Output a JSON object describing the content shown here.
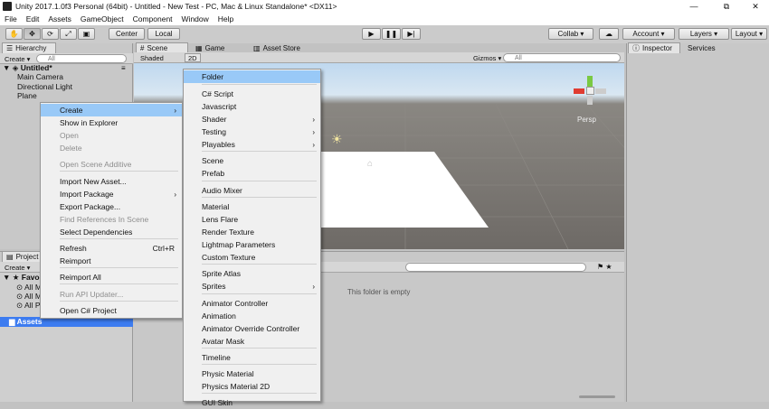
{
  "window": {
    "title": "Unity 2017.1.0f3 Personal (64bit) - Untitled - New Test - PC, Mac & Linux Standalone* <DX11>",
    "minimize": "—",
    "restore": "⧉",
    "close": "✕"
  },
  "menubar": [
    "File",
    "Edit",
    "Assets",
    "GameObject",
    "Component",
    "Window",
    "Help"
  ],
  "toolbar": {
    "center": "Center",
    "local": "Local",
    "collab": "Collab ▾",
    "cloud": "☁",
    "account": "Account",
    "layers": "Layers",
    "layout": "Layout"
  },
  "hierarchy": {
    "tab": "Hierarchy",
    "create": "Create ▾",
    "search_placeholder": "All",
    "scene_name": "Untitled*",
    "items": [
      "Main Camera",
      "Directional Light",
      "Plane"
    ]
  },
  "scene": {
    "tabs": [
      "Scene",
      "Game",
      "Asset Store"
    ],
    "shading": "Shaded",
    "mode_2d": "2D",
    "gizmos": "Gizmos ▾",
    "search_placeholder": "All",
    "persp": "Persp"
  },
  "inspector": {
    "tabs": [
      "Inspector",
      "Services"
    ]
  },
  "project": {
    "tab": "Project",
    "create": "Create ▾",
    "favorites": "Favori",
    "fav_items": [
      "All M",
      "All M",
      "All P"
    ],
    "assets": "Assets",
    "empty_text": "This folder is empty"
  },
  "context_menu": {
    "items": [
      {
        "label": "Create",
        "submenu": true,
        "highlight": true
      },
      {
        "label": "Show in Explorer"
      },
      {
        "label": "Open",
        "disabled": true
      },
      {
        "label": "Delete",
        "disabled": true
      },
      {
        "label": "Open Scene Additive",
        "disabled": true
      },
      {
        "label": "Import New Asset..."
      },
      {
        "label": "Import Package",
        "submenu": true
      },
      {
        "label": "Export Package..."
      },
      {
        "label": "Find References In Scene",
        "disabled": true
      },
      {
        "label": "Select Dependencies"
      },
      {
        "label": "Refresh",
        "shortcut": "Ctrl+R"
      },
      {
        "label": "Reimport"
      },
      {
        "label": "Reimport All"
      },
      {
        "label": "Run API Updater...",
        "disabled": true
      },
      {
        "label": "Open C# Project"
      }
    ]
  },
  "create_submenu": {
    "items": [
      {
        "label": "Folder",
        "highlight": true
      },
      {
        "label": "C# Script"
      },
      {
        "label": "Javascript"
      },
      {
        "label": "Shader",
        "submenu": true
      },
      {
        "label": "Testing",
        "submenu": true
      },
      {
        "label": "Playables",
        "submenu": true
      },
      {
        "label": "Scene"
      },
      {
        "label": "Prefab"
      },
      {
        "label": "Audio Mixer"
      },
      {
        "label": "Material"
      },
      {
        "label": "Lens Flare"
      },
      {
        "label": "Render Texture"
      },
      {
        "label": "Lightmap Parameters"
      },
      {
        "label": "Custom Texture"
      },
      {
        "label": "Sprite Atlas"
      },
      {
        "label": "Sprites",
        "submenu": true
      },
      {
        "label": "Animator Controller"
      },
      {
        "label": "Animation"
      },
      {
        "label": "Animator Override Controller"
      },
      {
        "label": "Avatar Mask"
      },
      {
        "label": "Timeline"
      },
      {
        "label": "Physic Material"
      },
      {
        "label": "Physics Material 2D"
      },
      {
        "label": "GUI Skin"
      }
    ]
  }
}
